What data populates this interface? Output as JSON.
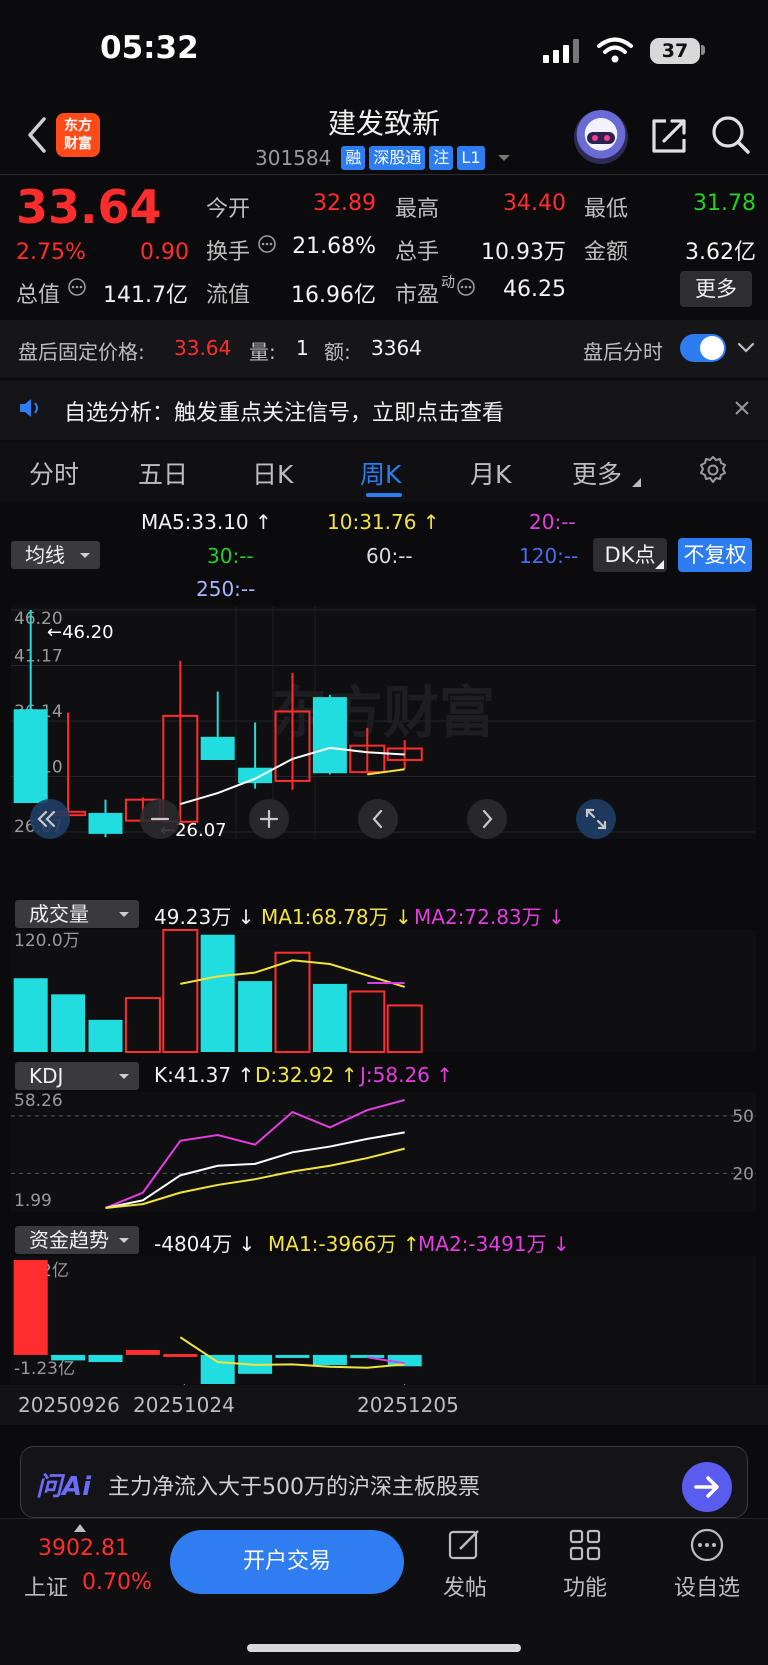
{
  "status": {
    "time": "05:32",
    "battery": "37"
  },
  "header": {
    "logo_line1": "东方",
    "logo_line2": "财富",
    "name": "建发致新",
    "code": "301584",
    "tags": [
      "融",
      "深股通",
      "注",
      "L1"
    ]
  },
  "quote": {
    "price": "33.64",
    "pct": "2.75%",
    "chg": "0.90",
    "rows": [
      [
        {
          "l": "今开",
          "v": "32.89",
          "c": "red"
        },
        {
          "l": "最高",
          "v": "34.40",
          "c": "red"
        },
        {
          "l": "最低",
          "v": "31.78",
          "c": "green"
        }
      ],
      [
        {
          "l": "换手",
          "v": "21.68%",
          "c": "white"
        },
        {
          "l": "总手",
          "v": "10.93万",
          "c": "white"
        },
        {
          "l": "金额",
          "v": "3.62亿",
          "c": "white"
        }
      ],
      [
        {
          "l": "流值",
          "v": "16.96亿",
          "c": "white"
        },
        {
          "l": "市盈",
          "v": "46.25",
          "c": "white"
        }
      ]
    ],
    "total_label": "总值",
    "total_value": "141.7亿",
    "pe_sup": "动",
    "more": "更多"
  },
  "after_hours": {
    "fixed_label": "盘后固定价格:",
    "fixed_value": "33.64",
    "vol_label": "量:",
    "vol_value": "1",
    "amt_label": "额:",
    "amt_value": "3364",
    "toggle_label": "盘后分时",
    "toggle_on": true
  },
  "notice": {
    "text": "自选分析：触发重点关注信号，立即点击查看"
  },
  "tabs": [
    "分时",
    "五日",
    "日K",
    "周K",
    "月K",
    "更多"
  ],
  "active_tab": "周K",
  "ma": {
    "dropdown": "均线",
    "ma5": "MA5:33.10",
    "ma10": "10:31.76",
    "ma20": "20:--",
    "ma30": "30:--",
    "ma60": "60:--",
    "ma120": "120:--",
    "ma250": "250:--",
    "dk": "DK点",
    "fq": "不复权"
  },
  "colors": {
    "up": "#ff2d2d",
    "down": "#21dde0",
    "ma5": "#ffffff",
    "ma10": "#f2e440",
    "ma20": "#e23ee0",
    "ma30": "#22d022",
    "ma120": "#4b6bf0",
    "ma250": "#a8b4ff",
    "accent": "#2d7cf0"
  },
  "chart_data": [
    {
      "type": "candlestick",
      "title": "",
      "y_ticks": [
        "46.20",
        "41.17",
        "36.14",
        "31.10",
        "26.07"
      ],
      "ylim": [
        26.07,
        46.2
      ],
      "max_label": "46.20",
      "min_label": "26.07",
      "watermark": "东方财富",
      "x_labels": [
        "20250926",
        "20251024",
        "20251205"
      ],
      "candles": [
        {
          "o": 37.2,
          "c": 28.7,
          "h": 46.2,
          "l": 28.7
        },
        {
          "o": 27.6,
          "c": 27.9,
          "h": 36.9,
          "l": 27.6
        },
        {
          "o": 27.8,
          "c": 25.9,
          "h": 29.0,
          "l": 25.6
        },
        {
          "o": 27.1,
          "c": 29.0,
          "h": 29.2,
          "l": 27.0
        },
        {
          "o": 27.0,
          "c": 36.6,
          "h": 41.6,
          "l": 27.0
        },
        {
          "o": 34.7,
          "c": 32.6,
          "h": 38.8,
          "l": 32.6
        },
        {
          "o": 31.9,
          "c": 30.5,
          "h": 36.0,
          "l": 30.0
        },
        {
          "o": 30.7,
          "c": 37.0,
          "h": 40.5,
          "l": 29.9
        },
        {
          "o": 38.3,
          "c": 31.4,
          "h": 38.5,
          "l": 31.3
        },
        {
          "o": 31.5,
          "c": 33.9,
          "h": 35.5,
          "l": 31.4
        },
        {
          "o": 32.6,
          "c": 33.64,
          "h": 34.4,
          "l": 31.78
        }
      ],
      "ma5": [
        null,
        null,
        null,
        null,
        28.6,
        29.6,
        30.9,
        32.7,
        33.7,
        33.3,
        33.1
      ],
      "ma10": [
        null,
        null,
        null,
        null,
        null,
        null,
        null,
        null,
        null,
        31.3,
        31.76
      ]
    },
    {
      "type": "bar",
      "title": "成交量",
      "value_label": "49.23万",
      "ma1_label": "MA1:68.78万",
      "ma2_label": "MA2:72.83万",
      "y_tick": "120.0万",
      "values": [
        78,
        61,
        34,
        57,
        129,
        124,
        75,
        105,
        72,
        64,
        49.23
      ],
      "dir": [
        "down",
        "down",
        "down",
        "up",
        "up",
        "down",
        "down",
        "up",
        "down",
        "up",
        "up"
      ],
      "ma1": [
        null,
        null,
        null,
        null,
        72,
        80,
        84,
        97,
        93,
        81,
        68.78
      ],
      "ma2": [
        null,
        null,
        null,
        null,
        null,
        null,
        null,
        null,
        null,
        73,
        72.83
      ]
    },
    {
      "type": "line",
      "title": "KDJ",
      "k_label": "K:41.37",
      "d_label": "D:32.92",
      "j_label": "J:58.26",
      "y_top": "58.26",
      "y_bottom": "1.99",
      "right_ticks": [
        "50",
        "20"
      ],
      "x": [
        3,
        4,
        5,
        6,
        7,
        8,
        9,
        10,
        11
      ],
      "K": [
        2,
        6,
        19,
        24,
        25,
        31,
        34,
        38,
        41.37
      ],
      "D": [
        2,
        4,
        10,
        14,
        17,
        21,
        24,
        28,
        32.92
      ],
      "J": [
        2,
        10,
        37,
        40,
        35,
        52,
        44,
        53,
        58.26
      ]
    },
    {
      "type": "bar",
      "title": "资金趋势",
      "value_label": "-4804万",
      "ma1_label": "MA1:-3966万",
      "ma2_label": "MA2:-3491万",
      "y_top": "4.02亿",
      "y_bottom": "-1.23亿",
      "values": [
        40200,
        -2300,
        -3000,
        2100,
        400,
        -12300,
        -8000,
        -900,
        -4300,
        -800,
        -4804
      ],
      "ma1": [
        null,
        null,
        null,
        null,
        7500,
        -3000,
        -4200,
        -4000,
        -5000,
        -5400,
        -3966
      ],
      "ma2": [
        null,
        null,
        null,
        null,
        null,
        null,
        null,
        null,
        null,
        -1000,
        -3491
      ]
    }
  ],
  "prompt": {
    "brand": "问Ai",
    "text": "主力净流入大于500万的沪深主板股票"
  },
  "bottom": {
    "index_value": "3902.81",
    "index_name": "上证",
    "index_pct": "0.70%",
    "trade": "开户交易",
    "post": "发帖",
    "func": "功能",
    "watch": "设自选"
  }
}
